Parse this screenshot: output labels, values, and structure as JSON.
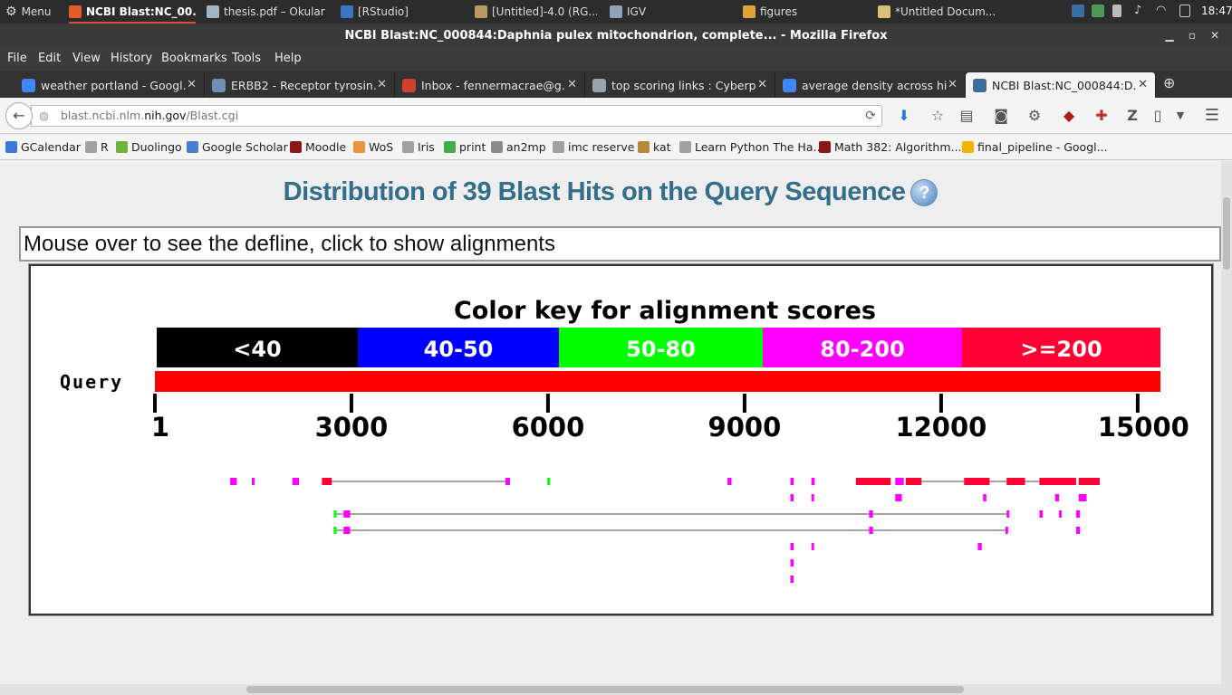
{
  "taskbar": {
    "menu_label": "Menu",
    "items": [
      {
        "label": "NCBI Blast:NC_00...",
        "color": "#e55b2b"
      },
      {
        "label": "thesis.pdf – Okular",
        "color": "#9fb6c9"
      },
      {
        "label": "[RStudio]",
        "color": "#3a77c0"
      },
      {
        "label": "[Untitled]-4.0 (RG...",
        "color": "#b99a60"
      },
      {
        "label": "IGV",
        "color": "#8da1b8"
      },
      {
        "label": "figures",
        "color": "#e2a23b"
      },
      {
        "label": "*Untitled Docum...",
        "color": "#d9c07a"
      }
    ],
    "clock": "18:47"
  },
  "window": {
    "title": "NCBI Blast:NC_000844:Daphnia pulex mitochondrion, complete... - Mozilla Firefox"
  },
  "menubar": [
    "File",
    "Edit",
    "View",
    "History",
    "Bookmarks",
    "Tools",
    "Help"
  ],
  "tabs": [
    {
      "label": "weather portland - Googl...",
      "icon": "google-icon",
      "color": "#4285f4"
    },
    {
      "label": "ERBB2 - Receptor tyrosin...",
      "icon": "uniprot-icon",
      "color": "#6c8fb3"
    },
    {
      "label": "Inbox - fennermacrae@g...",
      "icon": "gmail-icon",
      "color": "#d23f31"
    },
    {
      "label": "top scoring links : Cyberp...",
      "icon": "reddit-icon",
      "color": "#9aa3ad"
    },
    {
      "label": "average density across hi...",
      "icon": "google-icon",
      "color": "#4285f4"
    },
    {
      "label": "NCBI Blast:NC_000844:D...",
      "icon": "ncbi-icon",
      "color": "#3d6e9a",
      "selected": true
    }
  ],
  "navbar": {
    "url_prefix": "blast.ncbi.nlm.",
    "url_domain": "nih.gov",
    "url_suffix": "/Blast.cgi"
  },
  "bookmarks": [
    {
      "label": "GCalendar",
      "color": "#3b78d8"
    },
    {
      "label": "R",
      "color": "#a0a0a0"
    },
    {
      "label": "Duolingo",
      "color": "#6bb33b"
    },
    {
      "label": "Google Scholar",
      "color": "#4a7bd6"
    },
    {
      "label": "Moodle",
      "color": "#8a1a1a"
    },
    {
      "label": "WoS",
      "color": "#e8953a"
    },
    {
      "label": "Iris",
      "color": "#a0a0a0"
    },
    {
      "label": "print",
      "color": "#3fae49"
    },
    {
      "label": "an2mp",
      "color": "#8a8a8a"
    },
    {
      "label": "imc reserve",
      "color": "#a0a0a0"
    },
    {
      "label": "kat",
      "color": "#b58a3a"
    },
    {
      "label": "Learn Python The Ha...",
      "color": "#a0a0a0"
    },
    {
      "label": "Math 382: Algorithm...",
      "color": "#8a1a1a"
    },
    {
      "label": "final_pipeline - Googl...",
      "color": "#f4b400"
    }
  ],
  "page": {
    "title": "Distribution of 39 Blast Hits on the Query Sequence",
    "help_icon": "?",
    "defline": "Mouse over to see the defline, click to show alignments"
  },
  "chart_data": {
    "type": "bar",
    "title": "Color key for alignment scores",
    "key": [
      {
        "label": "<40",
        "color": "#000000"
      },
      {
        "label": "40-50",
        "color": "#0000ff"
      },
      {
        "label": "50-80",
        "color": "#00ff00"
      },
      {
        "label": "80-200",
        "color": "#ff00ff"
      },
      {
        "label": ">=200",
        "color": "#ff0033"
      }
    ],
    "query_label": "Query",
    "query_length": 15333,
    "ticks": [
      1,
      3000,
      6000,
      9000,
      12000,
      15000
    ],
    "tick_labels": [
      "1",
      "3000",
      "6000",
      "9000",
      "12000",
      "15000"
    ],
    "rows": [
      {
        "hsps": [
          [
            1150,
            1250,
            "80-200"
          ],
          [
            1480,
            1520,
            "80-200"
          ],
          [
            2100,
            2200,
            "80-200"
          ],
          [
            2550,
            2700,
            "ALL"
          ],
          [
            5350,
            5420,
            "80-200"
          ],
          [
            5990,
            6030,
            "50-80"
          ],
          [
            8740,
            8800,
            "80-200"
          ],
          [
            9700,
            9750,
            "80-200"
          ],
          [
            10020,
            10070,
            "80-200"
          ],
          [
            10700,
            11230,
            ">=200"
          ],
          [
            11300,
            11430,
            "80-200"
          ],
          [
            11460,
            11700,
            ">=200"
          ],
          [
            12350,
            12740,
            ">=200"
          ],
          [
            13000,
            13280,
            ">=200"
          ],
          [
            13500,
            14060,
            ">=200"
          ],
          [
            14100,
            14420,
            ">=200"
          ]
        ],
        "links": [
          [
            2700,
            5350
          ],
          [
            11700,
            12350
          ],
          [
            12740,
            13000
          ],
          [
            13280,
            13500
          ]
        ]
      },
      {
        "hsps": [
          [
            9700,
            9750,
            "80-200"
          ],
          [
            10020,
            10050,
            "80-200"
          ],
          [
            11300,
            11400,
            "80-200"
          ],
          [
            12640,
            12690,
            "80-200"
          ],
          [
            13740,
            13800,
            "80-200"
          ],
          [
            14100,
            14220,
            "80-200"
          ]
        ],
        "links": []
      },
      {
        "hsps": [
          [
            2730,
            2760,
            "50-80"
          ],
          [
            2880,
            2980,
            "80-200"
          ],
          [
            10900,
            10960,
            "80-200"
          ],
          [
            13000,
            13030,
            "80-200"
          ],
          [
            13500,
            13550,
            "80-200"
          ],
          [
            13800,
            13830,
            "80-200"
          ],
          [
            14060,
            14120,
            "80-200"
          ]
        ],
        "links": [
          [
            2760,
            2880
          ],
          [
            2980,
            10900
          ],
          [
            10960,
            13000
          ]
        ]
      },
      {
        "hsps": [
          [
            2730,
            2760,
            "50-80"
          ],
          [
            2880,
            2980,
            "80-200"
          ],
          [
            10900,
            10960,
            "80-200"
          ],
          [
            12980,
            13010,
            "80-200"
          ],
          [
            14060,
            14120,
            "80-200"
          ]
        ],
        "links": [
          [
            2760,
            2880
          ],
          [
            2980,
            10900
          ],
          [
            10960,
            12980
          ]
        ]
      },
      {
        "hsps": [
          [
            9700,
            9750,
            "80-200"
          ],
          [
            10020,
            10050,
            "80-200"
          ],
          [
            12560,
            12620,
            "80-200"
          ]
        ],
        "links": []
      },
      {
        "hsps": [
          [
            9700,
            9750,
            "80-200"
          ]
        ],
        "links": []
      },
      {
        "hsps": [
          [
            9700,
            9750,
            "80-200"
          ]
        ],
        "links": []
      }
    ]
  }
}
